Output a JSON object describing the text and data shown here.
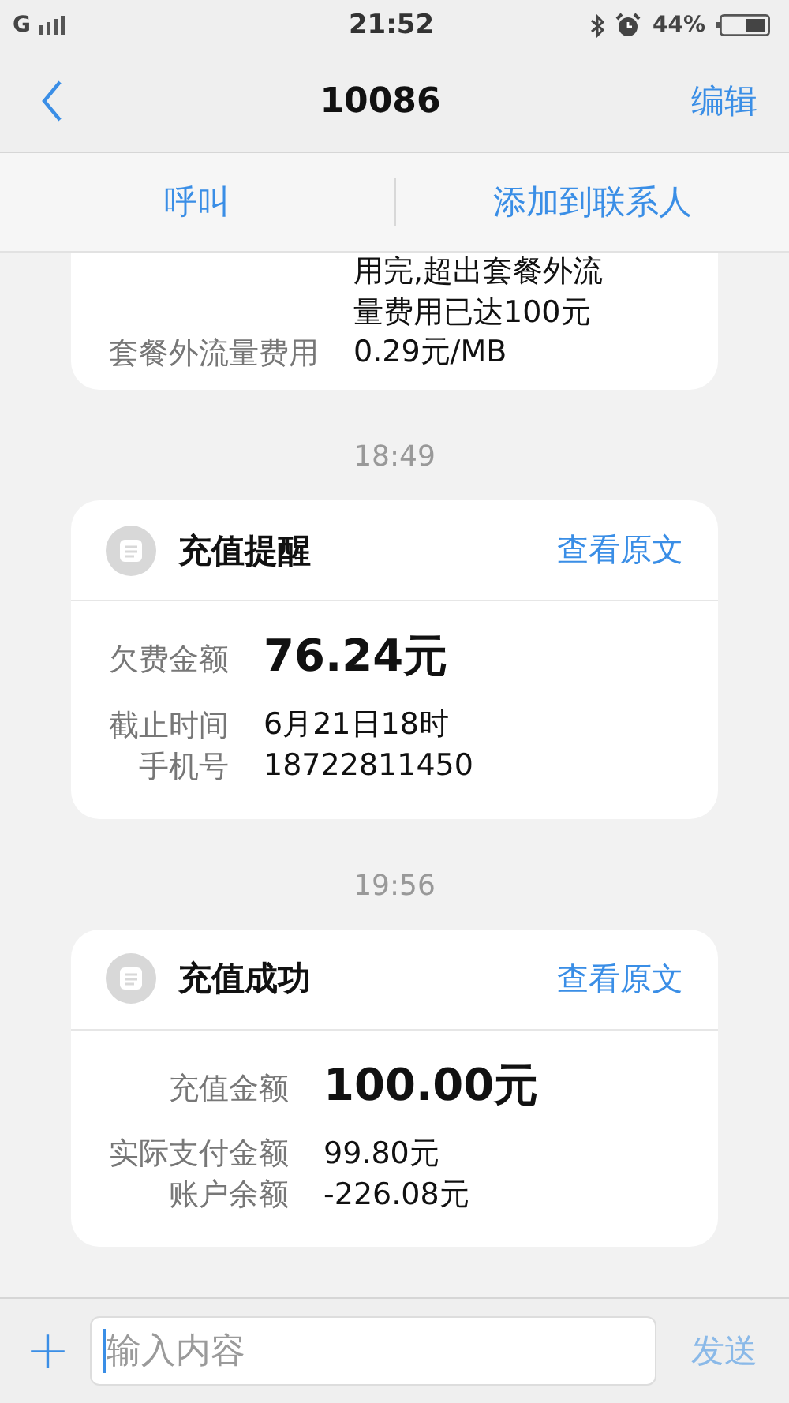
{
  "status_bar": {
    "network": "G",
    "time": "21:52",
    "battery": "44%"
  },
  "header": {
    "title": "10086",
    "edit": "编辑"
  },
  "actions": [
    {
      "label": "呼叫"
    },
    {
      "label": "添加到联系人"
    }
  ],
  "messages": [
    {
      "kind": "partial",
      "rows": [
        {
          "label": "",
          "lines": [
            "用完,超出套餐外流",
            "量费用已达100元"
          ],
          "emphasis": false
        },
        {
          "label": "套餐外流量费用",
          "lines": [
            "0.29元/MB"
          ],
          "emphasis": false
        }
      ]
    },
    {
      "kind": "card",
      "time": "18:49",
      "title": "充值提醒",
      "link": "查看原文",
      "rows": [
        {
          "label": "欠费金额",
          "lines": [
            "76.24元"
          ],
          "emphasis": true
        },
        {
          "label": "截止时间",
          "lines": [
            "6月21日18时"
          ],
          "emphasis": false
        },
        {
          "label": "手机号",
          "lines": [
            "18722811450"
          ],
          "emphasis": false
        }
      ]
    },
    {
      "kind": "card",
      "time": "19:56",
      "title": "充值成功",
      "link": "查看原文",
      "rows": [
        {
          "label": "充值金额",
          "lines": [
            "100.00元"
          ],
          "emphasis": true
        },
        {
          "label": "实际支付金额",
          "lines": [
            "99.80元"
          ],
          "emphasis": false
        },
        {
          "label": "账户余额",
          "lines": [
            "-226.08元"
          ],
          "emphasis": false
        }
      ]
    }
  ],
  "composer": {
    "add": "+",
    "placeholder": "输入内容",
    "send": "发送"
  }
}
